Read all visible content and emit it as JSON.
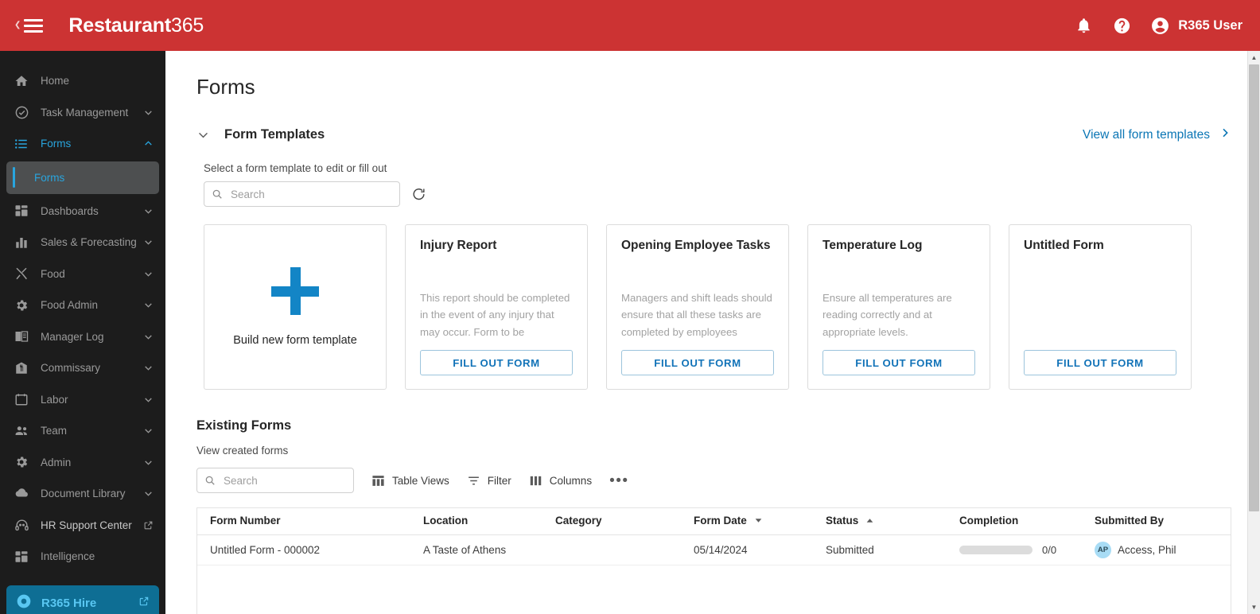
{
  "topbar": {
    "menu_icon": "hamburger-icon",
    "collapse_icon": "chevron-left-icon",
    "brand_bold": "Restaurant",
    "brand_light": "365",
    "notifications_icon": "bell-icon",
    "help_icon": "help-circle-icon",
    "account_icon": "account-circle-icon",
    "user_name": "R365 User",
    "bg_color": "#CC3333"
  },
  "sidebar": {
    "bg_color": "#1C1C1C",
    "accent_color": "#29A5DE",
    "items": [
      {
        "label": "Home",
        "icon": "home-icon",
        "expandable": false,
        "active": false
      },
      {
        "label": "Task Management",
        "icon": "check-circle-icon",
        "expandable": true,
        "active": false
      },
      {
        "label": "Forms",
        "icon": "list-icon",
        "expandable": true,
        "active": true,
        "expanded": true
      },
      {
        "label": "Dashboards",
        "icon": "dashboard-grid-icon",
        "expandable": true,
        "active": false
      },
      {
        "label": "Sales & Forecasting",
        "icon": "bar-chart-icon",
        "expandable": true,
        "active": false
      },
      {
        "label": "Food",
        "icon": "fork-knife-icon",
        "expandable": true,
        "active": false
      },
      {
        "label": "Food Admin",
        "icon": "gear-icon",
        "expandable": true,
        "active": false
      },
      {
        "label": "Manager Log",
        "icon": "book-icon",
        "expandable": true,
        "active": false
      },
      {
        "label": "Commissary",
        "icon": "commissary-icon",
        "expandable": true,
        "active": false
      },
      {
        "label": "Labor",
        "icon": "calendar-icon",
        "expandable": true,
        "active": false
      },
      {
        "label": "Team",
        "icon": "people-icon",
        "expandable": true,
        "active": false
      },
      {
        "label": "Admin",
        "icon": "gear-icon",
        "expandable": true,
        "active": false
      },
      {
        "label": "Document Library",
        "icon": "cloud-icon",
        "expandable": true,
        "active": false
      },
      {
        "label": "HR Support Center",
        "icon": "headset-icon",
        "expandable": false,
        "external": true,
        "active": false
      },
      {
        "label": "Intelligence",
        "icon": "dashboard-grid-icon",
        "expandable": false,
        "active": false
      }
    ],
    "sub_item": {
      "label": "Forms"
    },
    "promo": {
      "label": "R365 Hire",
      "icon": "hire-icon",
      "external_icon": "external-link-icon",
      "bg_color": "#0E6E94",
      "text_color": "#59C7F2"
    }
  },
  "page": {
    "title": "Forms"
  },
  "templates_section": {
    "collapse_icon": "chevron-down-icon",
    "title": "Form Templates",
    "view_all_label": "View all form templates",
    "view_all_icon": "chevron-right-icon",
    "hint": "Select a form template to edit or fill out",
    "search_placeholder": "Search",
    "search_value": "",
    "search_icon": "search-icon",
    "refresh_icon": "refresh-icon",
    "link_color": "#0B76B5"
  },
  "build_card": {
    "plus_icon": "plus-icon",
    "label": "Build new form template",
    "plus_color": "#1385C6"
  },
  "templates": [
    {
      "title": "Injury Report",
      "description": "This report should be completed in the event of any injury that may occur. Form to be completed by…",
      "button": "FILL OUT FORM"
    },
    {
      "title": "Opening Employee Tasks",
      "description": "Managers and shift leads should ensure that all these tasks are completed by employees before…",
      "button": "FILL OUT FORM"
    },
    {
      "title": "Temperature Log",
      "description": "Ensure all temperatures are reading correctly and at appropriate levels.",
      "button": "FILL OUT FORM"
    },
    {
      "title": "Untitled Form",
      "description": "",
      "button": "FILL OUT FORM"
    }
  ],
  "existing": {
    "title": "Existing Forms",
    "subtitle": "View created forms",
    "search_placeholder": "Search",
    "search_value": "",
    "search_icon": "search-icon",
    "tools": [
      {
        "label": "Table Views",
        "icon": "table-views-icon"
      },
      {
        "label": "Filter",
        "icon": "filter-icon"
      },
      {
        "label": "Columns",
        "icon": "columns-icon"
      }
    ],
    "more_icon": "ellipsis-icon",
    "columns": [
      {
        "label": "Form Number",
        "sort": "none"
      },
      {
        "label": "Location",
        "sort": "none"
      },
      {
        "label": "Category",
        "sort": "none"
      },
      {
        "label": "Form Date",
        "sort": "desc"
      },
      {
        "label": "Status",
        "sort": "asc"
      },
      {
        "label": "Completion",
        "sort": "none"
      },
      {
        "label": "Submitted By",
        "sort": "none"
      }
    ],
    "rows": [
      {
        "form_number": "Untitled Form - 000002",
        "location": "A Taste of Athens",
        "category": "",
        "form_date": "05/14/2024",
        "status": "Submitted",
        "completion_text": "0/0",
        "completion_pct": 0,
        "submitted_by": "Access, Phil",
        "submitted_by_initials": "AP"
      }
    ]
  },
  "scrollbar": {
    "up_icon": "caret-up-icon",
    "down_icon": "caret-down-icon"
  }
}
